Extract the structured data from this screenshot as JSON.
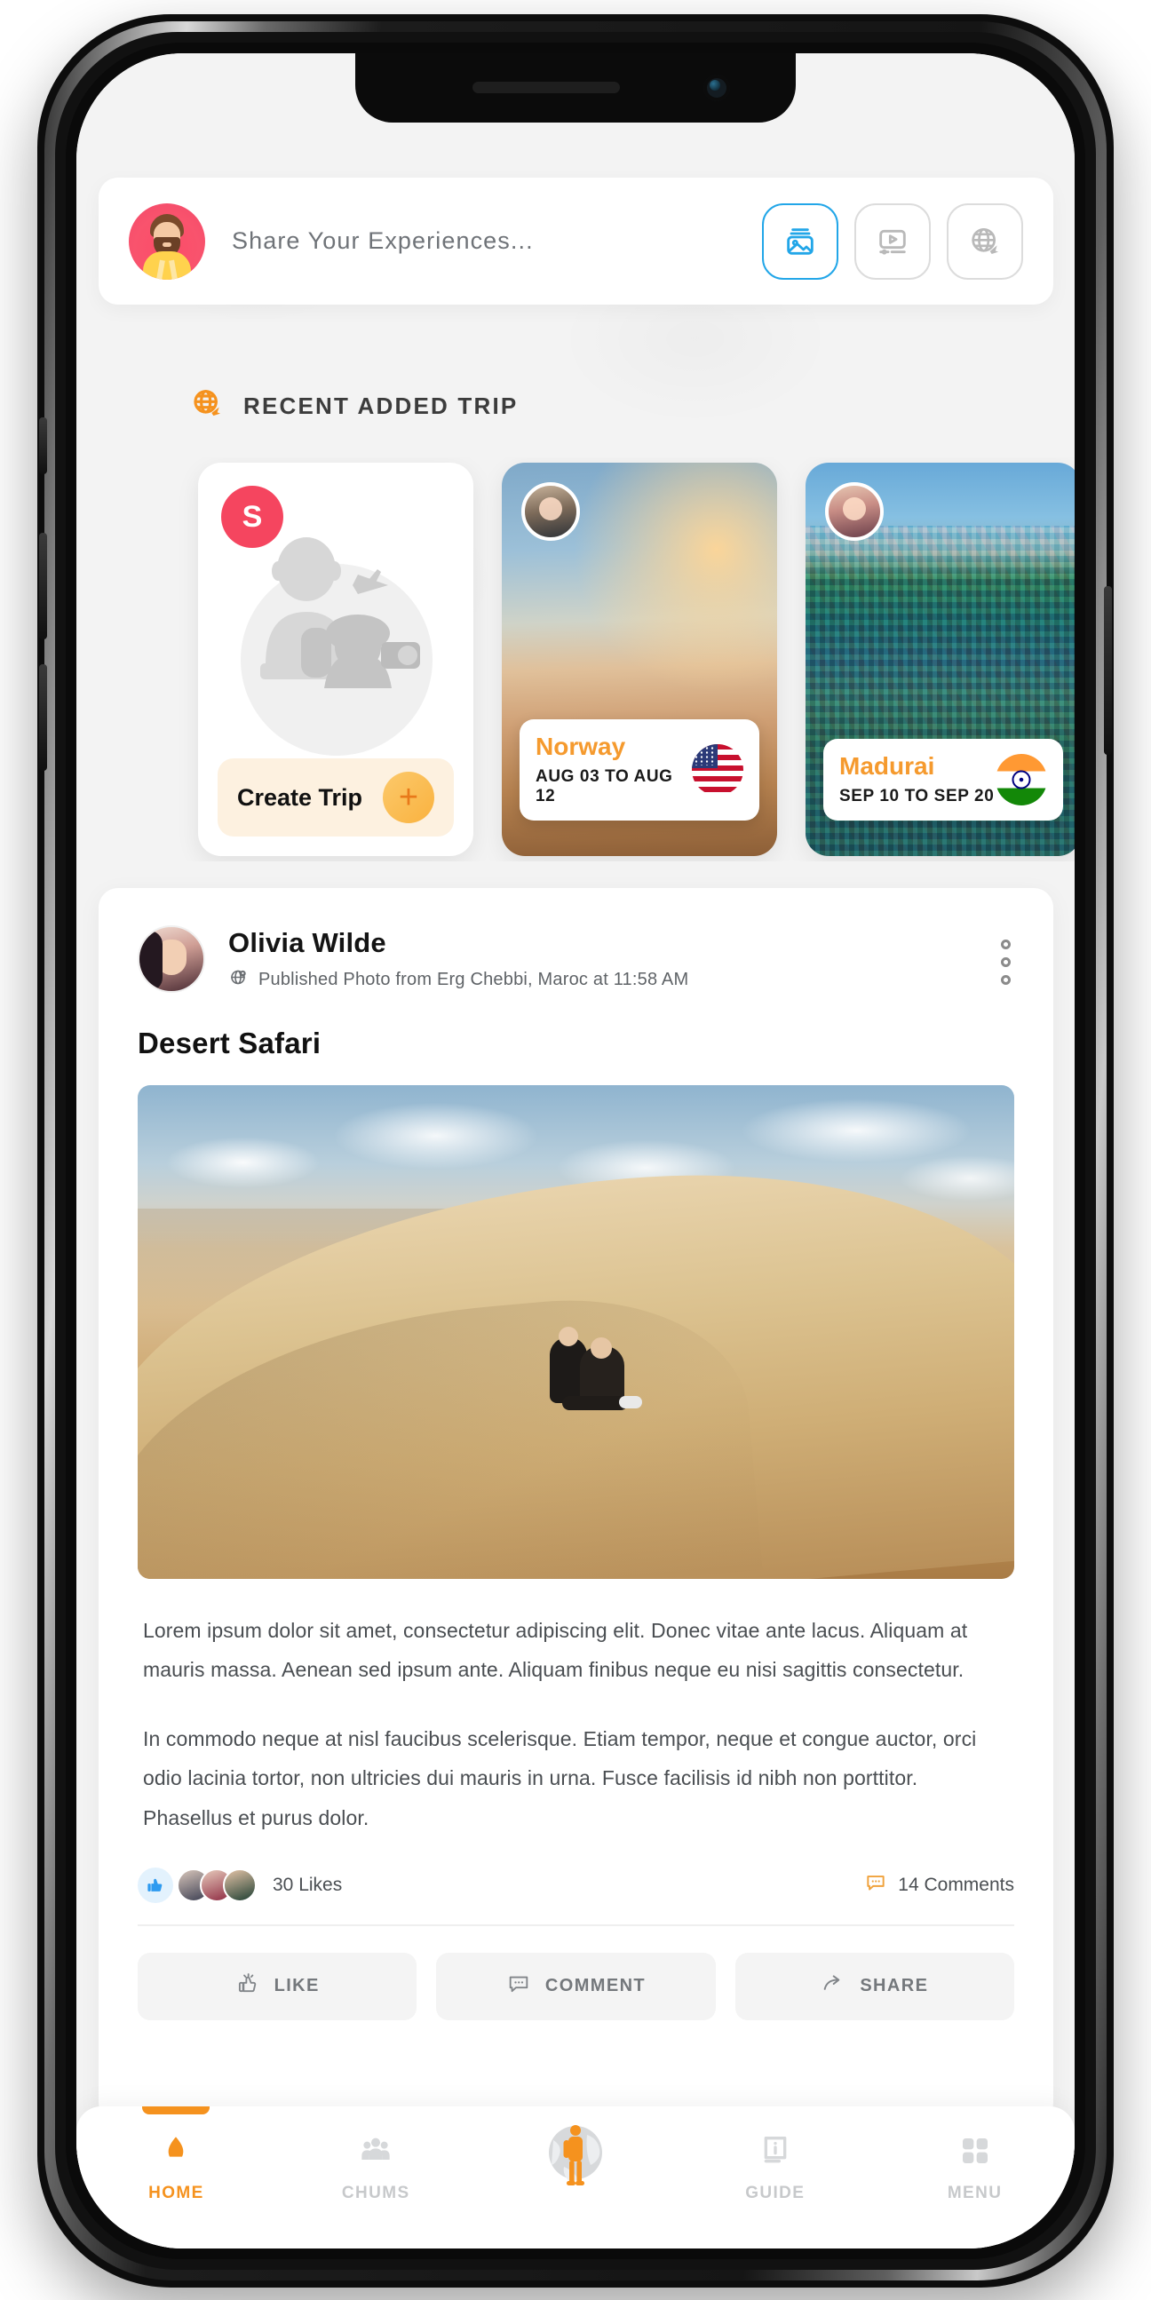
{
  "theme": {
    "accent_orange": "#f5921e",
    "accent_blue": "#22a6e8",
    "badge_red": "#f5455f",
    "screen_bg": "#f3f3f3",
    "card_bg": "#ffffff"
  },
  "share_bar": {
    "placeholder": "Share Your Experiences...",
    "avatar_name": "user-avatar",
    "actions": [
      {
        "id": "photo",
        "icon": "image-icon",
        "label": "Photo",
        "active": true
      },
      {
        "id": "video",
        "icon": "video-icon",
        "label": "Video",
        "active": false
      },
      {
        "id": "travel",
        "icon": "globe-plane-icon",
        "label": "Travel",
        "active": false
      }
    ]
  },
  "recent_section": {
    "icon": "globe-plane-icon",
    "title": "RECENT ADDED TRIP"
  },
  "trips": {
    "create_card": {
      "badge": "S",
      "button_label": "Create Trip",
      "plus_icon": "plus-icon",
      "illustration": "traveler-photographer-illustration"
    },
    "items": [
      {
        "name": "Norway",
        "dates": "AUG 03 TO AUG 12",
        "flag": "us-flag",
        "photo": "beach-sunset-traveler"
      },
      {
        "name": "Madurai",
        "dates": "SEP 10 TO SEP 20",
        "flag": "india-flag",
        "photo": "meenakshi-temple-gopuram"
      },
      {
        "name": "",
        "dates": "",
        "flag": "",
        "photo": "cliff-edge-traveler"
      }
    ]
  },
  "post": {
    "author": "Olivia Wilde",
    "meta": "Published Photo from Erg Chebbi, Maroc at 11:58 AM",
    "meta_icon": "globe-pin-icon",
    "more_icon": "more-vertical-icon",
    "title": "Desert Safari",
    "photo": "sahara-dune-couple-photo",
    "paragraphs": [
      "Lorem ipsum dolor sit amet, consectetur adipiscing elit. Donec vitae ante lacus. Aliquam at mauris massa. Aenean sed ipsum ante. Aliquam finibus neque eu nisi sagittis consectetur.",
      "In commodo neque at nisl faucibus scelerisque. Etiam tempor, neque et congue auctor, orci odio lacinia tortor, non ultricies dui mauris in urna. Fusce facilisis id nibh non porttitor. Phasellus et purus dolor."
    ],
    "engagement": {
      "likes_text": "30 Likes",
      "likes_icon": "thumbs-up-icon",
      "comments_text": "14 Comments",
      "comments_icon": "comment-icon"
    },
    "actions": [
      {
        "label": "LIKE",
        "icon": "thumbs-up-icon"
      },
      {
        "label": "COMMENT",
        "icon": "comment-icon"
      },
      {
        "label": "SHARE",
        "icon": "share-arrow-icon"
      }
    ]
  },
  "bottom_nav": {
    "items": [
      {
        "label": "HOME",
        "icon": "home-icon",
        "active": true
      },
      {
        "label": "CHUMS",
        "icon": "people-icon",
        "active": false
      },
      {
        "label": "",
        "icon": "globe-traveler-icon",
        "active": false
      },
      {
        "label": "GUIDE",
        "icon": "info-book-icon",
        "active": false
      },
      {
        "label": "MENU",
        "icon": "grid-icon",
        "active": false
      }
    ]
  }
}
